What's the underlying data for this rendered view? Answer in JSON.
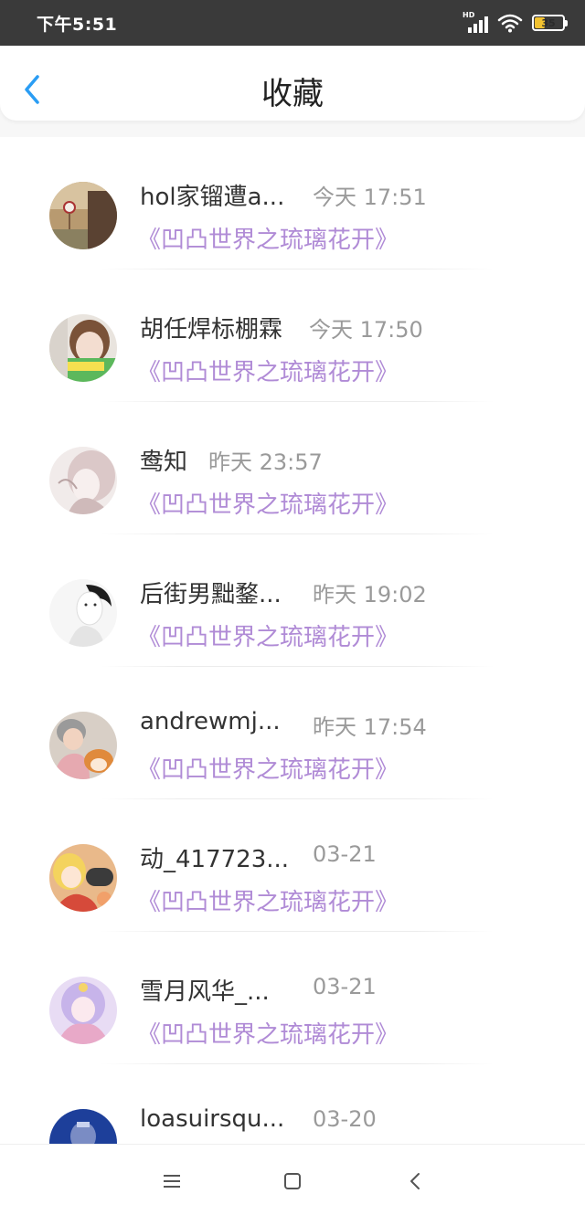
{
  "status_bar": {
    "time": "下午5:51",
    "battery": "35",
    "battery_level": 0.35,
    "network": "HD",
    "battery_color": "#f2c230"
  },
  "header": {
    "title": "收藏",
    "back_icon": "chevron-left-icon",
    "accent_color": "#2a9df4"
  },
  "list": [
    {
      "name": "hol家镏遭a...",
      "time": "今天 17:51",
      "work": "《凹凸世界之琉璃花开》",
      "avatar": "avatar-1"
    },
    {
      "name": "胡任焊标棚霖",
      "time": "今天 17:50",
      "work": "《凹凸世界之琉璃花开》",
      "avatar": "avatar-2"
    },
    {
      "name": "鸯知",
      "time": "昨天 23:57",
      "work": "《凹凸世界之琉璃花开》",
      "avatar": "avatar-3"
    },
    {
      "name": "后街男黜鍪...",
      "time": "昨天 19:02",
      "work": "《凹凸世界之琉璃花开》",
      "avatar": "avatar-4"
    },
    {
      "name": "andrewmj...",
      "time": "昨天 17:54",
      "work": "《凹凸世界之琉璃花开》",
      "avatar": "avatar-5"
    },
    {
      "name": "动_417723...",
      "time": "03-21",
      "work": "《凹凸世界之琉璃花开》",
      "avatar": "avatar-6"
    },
    {
      "name": "雪月风华_...",
      "time": "03-21",
      "work": "《凹凸世界之琉璃花开》",
      "avatar": "avatar-7"
    },
    {
      "name": "loasuirsqu...",
      "time": "03-20",
      "work": "",
      "avatar": "avatar-8"
    }
  ],
  "colors": {
    "work_link": "#b08bd6",
    "timestamp": "#9a9a9a",
    "name": "#333333"
  },
  "nav_bar": {
    "menu_icon": "menu-icon",
    "home_icon": "home-square-icon",
    "back_icon": "back-triangle-icon"
  }
}
